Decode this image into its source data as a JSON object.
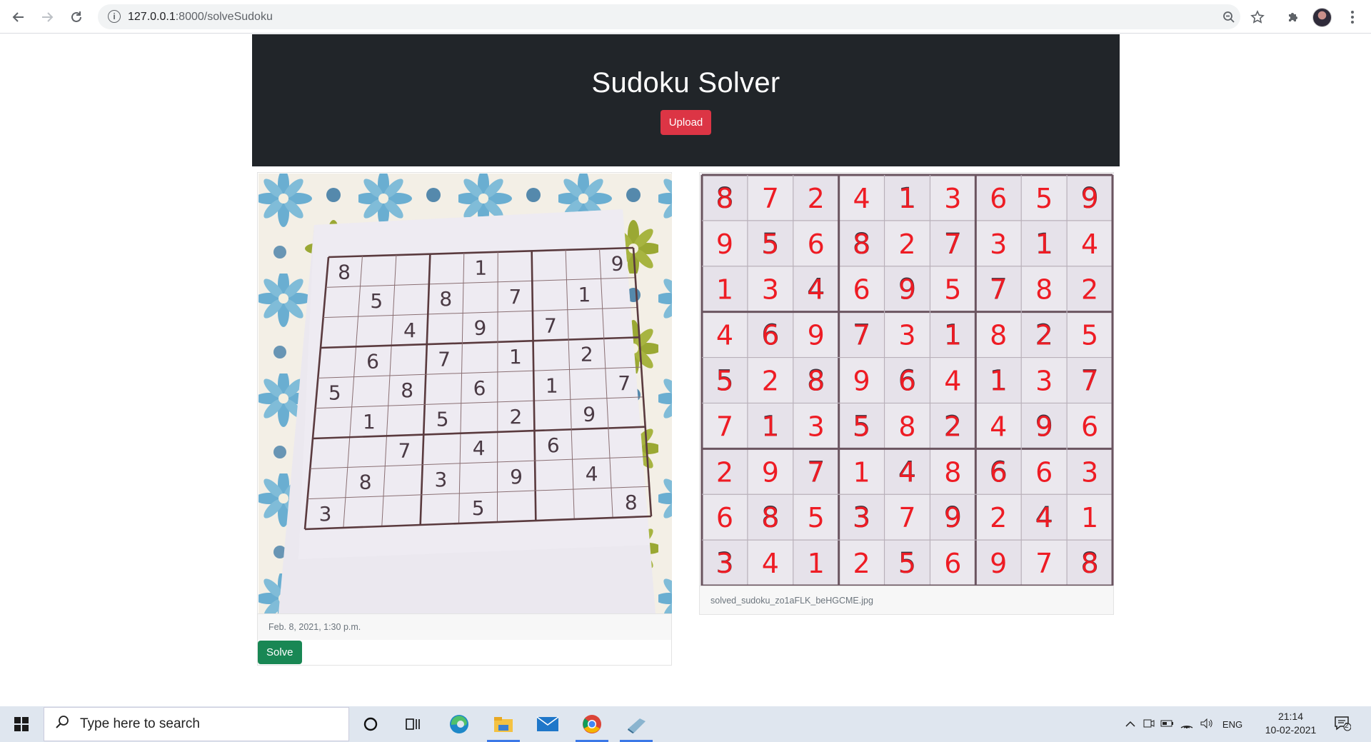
{
  "browser": {
    "url_host": "127.0.0.1",
    "url_path": ":8000/solveSudoku",
    "back_icon": "arrow-left-icon",
    "forward_icon": "arrow-right-icon",
    "reload_icon": "reload-icon"
  },
  "header": {
    "title": "Sudoku Solver",
    "upload_label": "Upload"
  },
  "left_card": {
    "date": "Feb. 8, 2021, 1:30 p.m.",
    "solve_label": "Solve",
    "original_grid": [
      [
        "8",
        "",
        "",
        "",
        "1",
        "",
        "",
        "",
        "9"
      ],
      [
        "",
        "5",
        "",
        "8",
        "",
        "7",
        "",
        "1",
        ""
      ],
      [
        "",
        "",
        "4",
        "",
        "9",
        "",
        "7",
        "",
        ""
      ],
      [
        "",
        "6",
        "",
        "7",
        "",
        "1",
        "",
        "2",
        ""
      ],
      [
        "5",
        "",
        "8",
        "",
        "6",
        "",
        "1",
        "",
        "7"
      ],
      [
        "",
        "1",
        "",
        "5",
        "",
        "2",
        "",
        "9",
        ""
      ],
      [
        "",
        "",
        "7",
        "",
        "4",
        "",
        "6",
        "",
        ""
      ],
      [
        "",
        "8",
        "",
        "3",
        "",
        "9",
        "",
        "4",
        ""
      ],
      [
        "3",
        "",
        "",
        "",
        "5",
        "",
        "",
        "",
        "8"
      ]
    ]
  },
  "right_card": {
    "filename": "solved_sudoku_zo1aFLK_beHGCME.jpg",
    "solved_grid": [
      [
        "8",
        "7",
        "2",
        "4",
        "1",
        "3",
        "6",
        "5",
        "9"
      ],
      [
        "9",
        "5",
        "6",
        "8",
        "2",
        "7",
        "3",
        "1",
        "4"
      ],
      [
        "1",
        "3",
        "4",
        "6",
        "9",
        "5",
        "7",
        "8",
        "2"
      ],
      [
        "4",
        "6",
        "9",
        "7",
        "3",
        "1",
        "8",
        "2",
        "5"
      ],
      [
        "5",
        "2",
        "8",
        "9",
        "6",
        "4",
        "1",
        "3",
        "7"
      ],
      [
        "7",
        "1",
        "3",
        "5",
        "8",
        "2",
        "4",
        "9",
        "6"
      ],
      [
        "2",
        "9",
        "7",
        "1",
        "4",
        "8",
        "6",
        "6",
        "3"
      ],
      [
        "6",
        "8",
        "5",
        "3",
        "7",
        "9",
        "2",
        "4",
        "1"
      ],
      [
        "3",
        "4",
        "1",
        "2",
        "5",
        "6",
        "9",
        "7",
        "8"
      ]
    ]
  },
  "taskbar": {
    "search_placeholder": "Type here to search",
    "language": "ENG",
    "time": "21:14",
    "date": "10-02-2021",
    "notification_count": "2"
  }
}
